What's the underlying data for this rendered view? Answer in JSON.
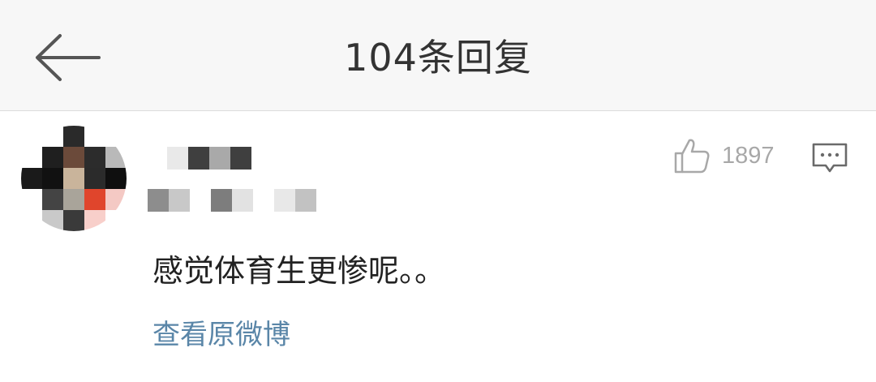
{
  "header": {
    "title": "104条回复",
    "back_icon": "back-arrow-icon"
  },
  "comment": {
    "avatar_icon": "avatar-blurred",
    "like_count": "1897",
    "like_icon": "thumbs-up-icon",
    "reply_icon": "comment-bubble-icon",
    "text": "感觉体育生更惨呢。。",
    "view_original_label": "查看原微博"
  },
  "colors": {
    "header_bg": "#f7f7f7",
    "link": "#5a86a8",
    "muted": "#a8a8a8"
  }
}
